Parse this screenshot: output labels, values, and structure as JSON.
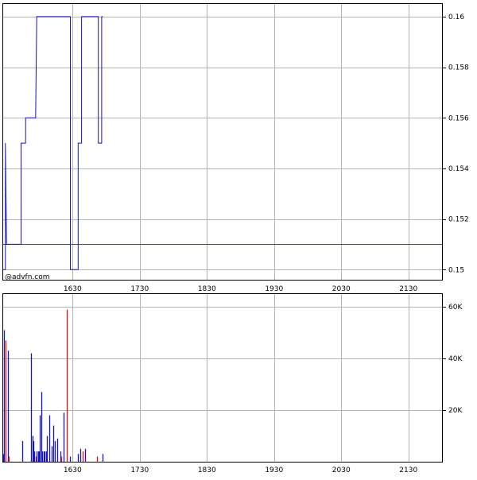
{
  "watermark": "@advfn.com",
  "colors": {
    "price_line": "#1515c8",
    "reference_line": "#dd1111",
    "volume_up": "#1515c8",
    "volume_down": "#dd1111",
    "grid": "#b4b4b4"
  },
  "chart_data": [
    {
      "type": "line",
      "name": "price",
      "x_ticks": [
        "1630",
        "1730",
        "1830",
        "1930",
        "2030",
        "2130"
      ],
      "x_tick_minutes": [
        990,
        1050,
        1110,
        1170,
        1230,
        1290
      ],
      "xlim_minutes": [
        928,
        1320
      ],
      "ylim": [
        0.1496,
        0.1605
      ],
      "y_ticks": [
        "0.15",
        "0.152",
        "0.154",
        "0.156",
        "0.158",
        "0.16"
      ],
      "y_tick_values": [
        0.15,
        0.152,
        0.154,
        0.156,
        0.158,
        0.16
      ],
      "reference_value": 0.151,
      "grid": true,
      "series": [
        {
          "x_minutes": [
            928,
            930,
            930,
            931,
            932,
            932,
            934,
            943,
            944,
            944,
            947,
            947,
            948,
            948,
            957,
            958,
            958,
            987,
            988,
            988,
            994,
            995,
            995,
            997,
            998,
            998,
            1012,
            1013,
            1013,
            1014,
            1016,
            1016,
            1017
          ],
          "y": [
            0.15,
            0.15,
            0.155,
            0.151,
            0.151,
            0.151,
            0.151,
            0.151,
            0.151,
            0.155,
            0.155,
            0.155,
            0.155,
            0.156,
            0.156,
            0.16,
            0.16,
            0.16,
            0.16,
            0.15,
            0.15,
            0.15,
            0.155,
            0.155,
            0.155,
            0.16,
            0.16,
            0.16,
            0.155,
            0.155,
            0.155,
            0.16,
            0.16
          ]
        }
      ]
    },
    {
      "type": "bar",
      "name": "volume",
      "x_ticks": [
        "1630",
        "1730",
        "1830",
        "1930",
        "2030",
        "2130"
      ],
      "x_tick_minutes": [
        990,
        1050,
        1110,
        1170,
        1230,
        1290
      ],
      "xlim_minutes": [
        928,
        1320
      ],
      "ylim": [
        0,
        65000
      ],
      "y_ticks": [
        "20K",
        "40K",
        "60K"
      ],
      "y_tick_values": [
        20000,
        40000,
        60000
      ],
      "grid": true,
      "bars": [
        {
          "x": 928,
          "v": 3000,
          "dir": "up"
        },
        {
          "x": 929,
          "v": 51000,
          "dir": "up"
        },
        {
          "x": 930,
          "v": 47000,
          "dir": "down"
        },
        {
          "x": 932,
          "v": 43000,
          "dir": "up"
        },
        {
          "x": 933,
          "v": 2000,
          "dir": "down"
        },
        {
          "x": 945,
          "v": 8000,
          "dir": "up"
        },
        {
          "x": 953,
          "v": 42000,
          "dir": "up"
        },
        {
          "x": 954,
          "v": 10000,
          "dir": "up"
        },
        {
          "x": 955,
          "v": 8000,
          "dir": "up"
        },
        {
          "x": 956,
          "v": 4000,
          "dir": "up"
        },
        {
          "x": 957,
          "v": 2000,
          "dir": "down"
        },
        {
          "x": 958,
          "v": 4000,
          "dir": "up"
        },
        {
          "x": 959,
          "v": 4000,
          "dir": "up"
        },
        {
          "x": 960,
          "v": 4000,
          "dir": "up"
        },
        {
          "x": 961,
          "v": 18000,
          "dir": "up"
        },
        {
          "x": 962,
          "v": 27000,
          "dir": "up"
        },
        {
          "x": 963,
          "v": 4000,
          "dir": "up"
        },
        {
          "x": 964,
          "v": 4000,
          "dir": "up"
        },
        {
          "x": 965,
          "v": 4000,
          "dir": "up"
        },
        {
          "x": 966,
          "v": 4000,
          "dir": "up"
        },
        {
          "x": 967,
          "v": 10000,
          "dir": "up"
        },
        {
          "x": 969,
          "v": 18000,
          "dir": "up"
        },
        {
          "x": 971,
          "v": 6000,
          "dir": "up"
        },
        {
          "x": 973,
          "v": 14000,
          "dir": "up"
        },
        {
          "x": 974,
          "v": 8000,
          "dir": "up"
        },
        {
          "x": 976,
          "v": 9000,
          "dir": "up"
        },
        {
          "x": 979,
          "v": 4000,
          "dir": "up"
        },
        {
          "x": 980,
          "v": 2000,
          "dir": "down"
        },
        {
          "x": 982,
          "v": 19000,
          "dir": "up"
        },
        {
          "x": 985,
          "v": 59000,
          "dir": "down"
        },
        {
          "x": 988,
          "v": 2000,
          "dir": "up"
        },
        {
          "x": 995,
          "v": 3000,
          "dir": "up"
        },
        {
          "x": 997,
          "v": 5000,
          "dir": "up"
        },
        {
          "x": 999,
          "v": 4000,
          "dir": "down"
        },
        {
          "x": 1001,
          "v": 5000,
          "dir": "up"
        },
        {
          "x": 1012,
          "v": 2000,
          "dir": "down"
        },
        {
          "x": 1017,
          "v": 3000,
          "dir": "up"
        }
      ]
    }
  ]
}
